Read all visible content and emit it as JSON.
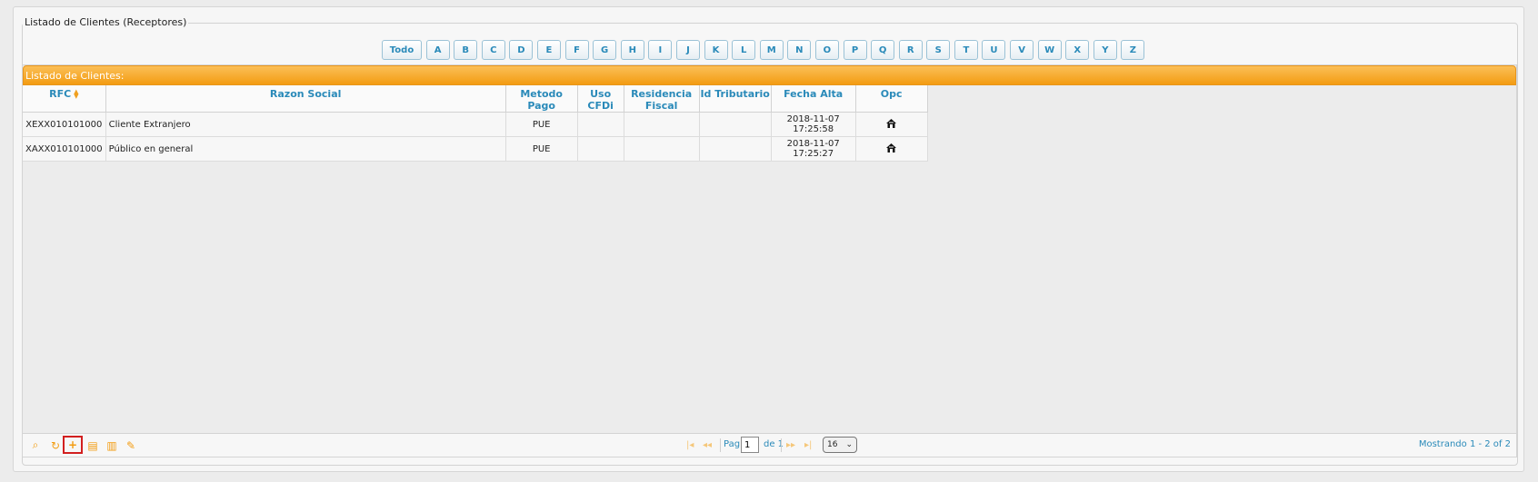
{
  "title": "Listado de Clientes (Receptores)",
  "alphabet": [
    "Todo",
    "A",
    "B",
    "C",
    "D",
    "E",
    "F",
    "G",
    "H",
    "I",
    "J",
    "K",
    "L",
    "M",
    "N",
    "O",
    "P",
    "Q",
    "R",
    "S",
    "T",
    "U",
    "V",
    "W",
    "X",
    "Y",
    "Z"
  ],
  "grid": {
    "caption": "Listado de Clientes:",
    "columns": [
      "RFC",
      "Razon Social",
      "Metodo Pago",
      "Uso CFDi",
      "Residencia Fiscal",
      "Id Tributario",
      "Fecha Alta",
      "Opc"
    ],
    "rows": [
      {
        "rfc": "XEXX010101000",
        "razon": "Cliente Extranjero",
        "metodo": "PUE",
        "uso": "",
        "residencia": "",
        "id_trib": "",
        "fecha": "2018-11-07 17:25:58",
        "opc_icon": "edit-house-icon"
      },
      {
        "rfc": "XAXX010101000",
        "razon": "Público en general",
        "metodo": "PUE",
        "uso": "",
        "residencia": "",
        "id_trib": "",
        "fecha": "2018-11-07 17:25:27",
        "opc_icon": "edit-house-icon"
      }
    ]
  },
  "pager": {
    "page_label": "Pag",
    "page_value": "1",
    "of_label": "de 1",
    "rows_per_page": "16",
    "view_info": "Mostrando 1 - 2 of 2",
    "icons": [
      "search-icon",
      "refresh-icon",
      "add-icon",
      "columns-icon",
      "export-icon",
      "notes-icon"
    ]
  },
  "colors": {
    "accent": "#f39c12",
    "link": "#2a8ab9",
    "highlight": "#d21f1f"
  }
}
